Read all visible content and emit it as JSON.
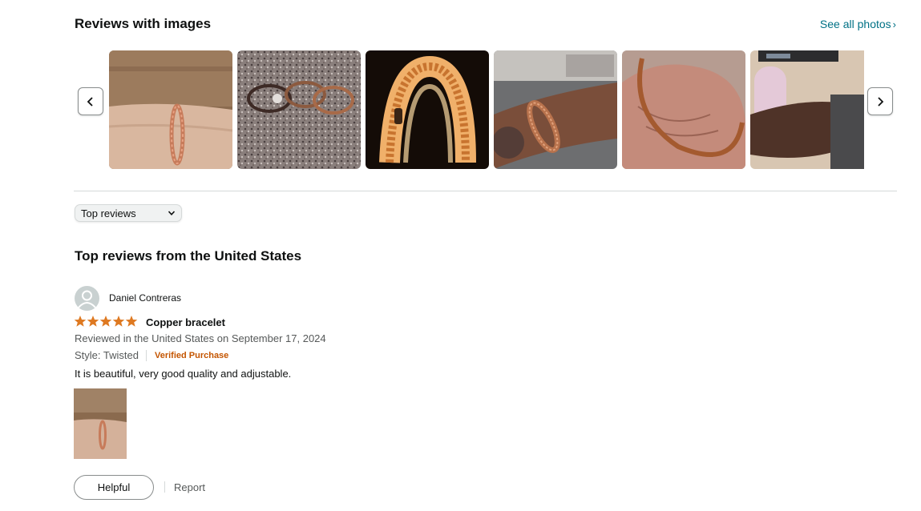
{
  "images_section": {
    "title": "Reviews with images",
    "see_all_label": "See all photos",
    "thumbnails": [
      {
        "icon": "bracelet-photo-wrist"
      },
      {
        "icon": "bracelet-photo-granite"
      },
      {
        "icon": "bracelet-photo-glowing"
      },
      {
        "icon": "bracelet-photo-tattoo-wrist"
      },
      {
        "icon": "bracelet-photo-palm"
      },
      {
        "icon": "bracelet-photo-sleeve"
      }
    ]
  },
  "sort": {
    "selected": "Top reviews"
  },
  "reviews_section": {
    "title": "Top reviews from the United States"
  },
  "review": {
    "reviewer": "Daniel Contreras",
    "rating": 5,
    "title": "Copper bracelet",
    "date_line": "Reviewed in the United States on September 17, 2024",
    "style": "Style: Twisted",
    "verified": "Verified Purchase",
    "body": "It is beautiful, very good quality and adjustable.",
    "helpful_label": "Helpful",
    "report_label": "Report"
  },
  "colors": {
    "link": "#007185",
    "star": "#de7921",
    "verified": "#c45500",
    "muted_text": "#565959"
  }
}
